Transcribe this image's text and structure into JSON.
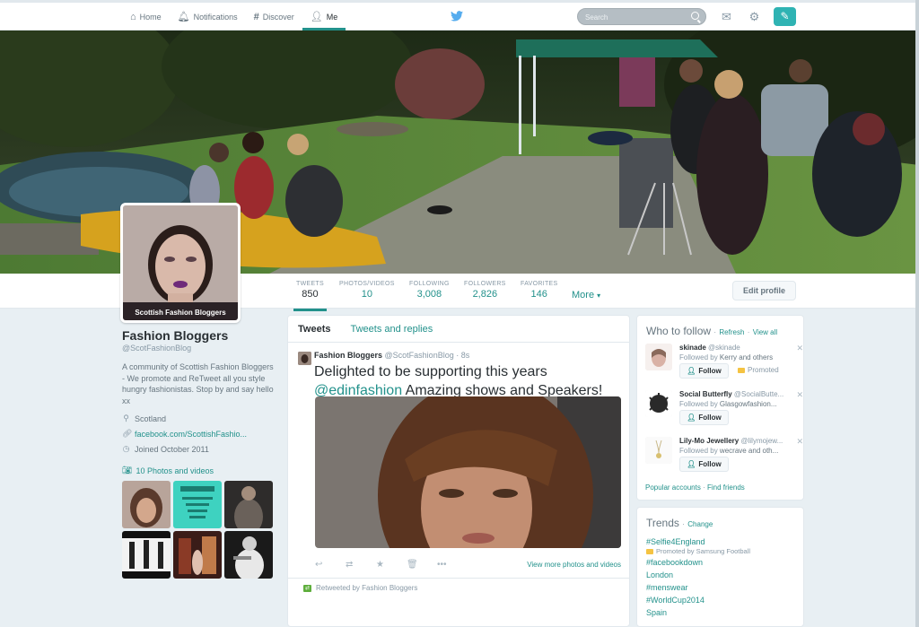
{
  "nav": {
    "items": [
      {
        "label": "Home",
        "icon": "home-icon"
      },
      {
        "label": "Notifications",
        "icon": "bell-icon"
      },
      {
        "label": "Discover",
        "icon": "hash-icon"
      },
      {
        "label": "Me",
        "icon": "person-icon"
      }
    ],
    "search_placeholder": "Search"
  },
  "colors": {
    "accent": "#22918b",
    "tweet_button": "#2fb3b3"
  },
  "avatar": {
    "caption": "Scottish Fashion Bloggers"
  },
  "stats": [
    {
      "label": "Tweets",
      "value": "850"
    },
    {
      "label": "Photos/Videos",
      "value": "10"
    },
    {
      "label": "Following",
      "value": "3,008"
    },
    {
      "label": "Followers",
      "value": "2,826"
    },
    {
      "label": "Favorites",
      "value": "146"
    }
  ],
  "more_label": "More",
  "edit_profile_label": "Edit profile",
  "profile": {
    "name": "Fashion Bloggers",
    "handle": "@ScotFashionBlog",
    "bio": "A community of Scottish Fashion Bloggers - We promote and ReTweet all you style hungry fashionistas. Stop by and say hello xx",
    "location": "Scotland",
    "website": "facebook.com/ScottishFashio...",
    "joined": "Joined October 2011",
    "photos_link": "10 Photos and videos"
  },
  "timeline": {
    "tabs": [
      "Tweets",
      "Tweets and replies"
    ],
    "tweet": {
      "name": "Fashion Bloggers",
      "handle": "@ScotFashionBlog",
      "time": "· 8s",
      "text_before": "Delighted to be supporting this years",
      "mention": "@edinfashion",
      "text_after": "Amazing shows and Speakers!",
      "view_more": "View more photos and videos"
    },
    "retweeted_by": "Retweeted by Fashion Bloggers"
  },
  "who_to_follow": {
    "title": "Who to follow",
    "refresh": "Refresh",
    "view_all": "View all",
    "follow_label": "Follow",
    "promoted_label": "Promoted",
    "suggestions": [
      {
        "name": "skinade",
        "handle": "@skinade",
        "followed_prefix": "Followed by",
        "followed_by": "Kerry and others"
      },
      {
        "name": "Social Butterfly",
        "handle": "@SocialButte...",
        "followed_prefix": "Followed by",
        "followed_by": "Glasgowfashion..."
      },
      {
        "name": "Lily-Mo Jewellery",
        "handle": "@lilymojew...",
        "followed_prefix": "Followed by",
        "followed_by": "wecrave and oth..."
      }
    ],
    "popular_accounts": "Popular accounts",
    "find_friends": "Find friends"
  },
  "trends": {
    "title": "Trends",
    "change": "Change",
    "items": [
      {
        "label": "#Selfie4England"
      },
      {
        "label": "#facebookdown"
      },
      {
        "label": "London"
      },
      {
        "label": "#menswear"
      },
      {
        "label": "#WorldCup2014"
      },
      {
        "label": "Spain"
      }
    ],
    "promoted_by": "Promoted by Samsung Football"
  }
}
